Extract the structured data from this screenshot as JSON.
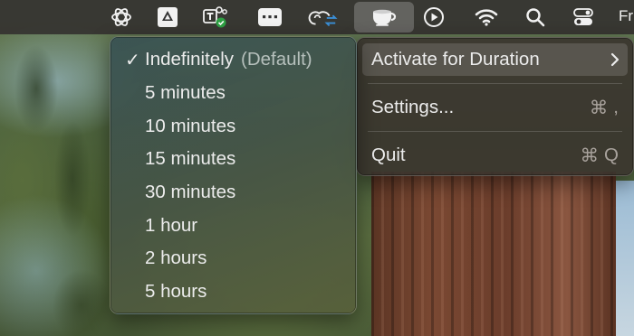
{
  "menubar": {
    "clock_partial": "Fr",
    "icons": [
      "openai-icon",
      "google-drive-icon",
      "teams-icon",
      "keyboard-window-icon",
      "creative-cloud-sync-icon",
      "coffee-cup-icon",
      "play-circle-icon",
      "wifi-icon",
      "search-icon",
      "control-center-icon"
    ]
  },
  "main_menu": {
    "items": [
      {
        "label": "Activate for Duration",
        "has_submenu": true,
        "highlighted": true
      },
      {
        "label": "Settings...",
        "shortcut_symbol": "⌘",
        "shortcut_key": ","
      },
      {
        "label": "Quit",
        "shortcut_symbol": "⌘",
        "shortcut_key": "Q"
      }
    ]
  },
  "submenu": {
    "checkmark": "✓",
    "items": [
      {
        "label": "Indefinitely",
        "hint": "(Default)",
        "checked": true
      },
      {
        "label": "5 minutes"
      },
      {
        "label": "10 minutes"
      },
      {
        "label": "15 minutes"
      },
      {
        "label": "30 minutes"
      },
      {
        "label": "1 hour"
      },
      {
        "label": "2 hours"
      },
      {
        "label": "5 hours"
      }
    ]
  },
  "colors": {
    "menubar_bg": "#343230",
    "menu_text": "#ececec",
    "shortcut_text": "#a8a29c",
    "teams_badge": "#2ea043"
  }
}
